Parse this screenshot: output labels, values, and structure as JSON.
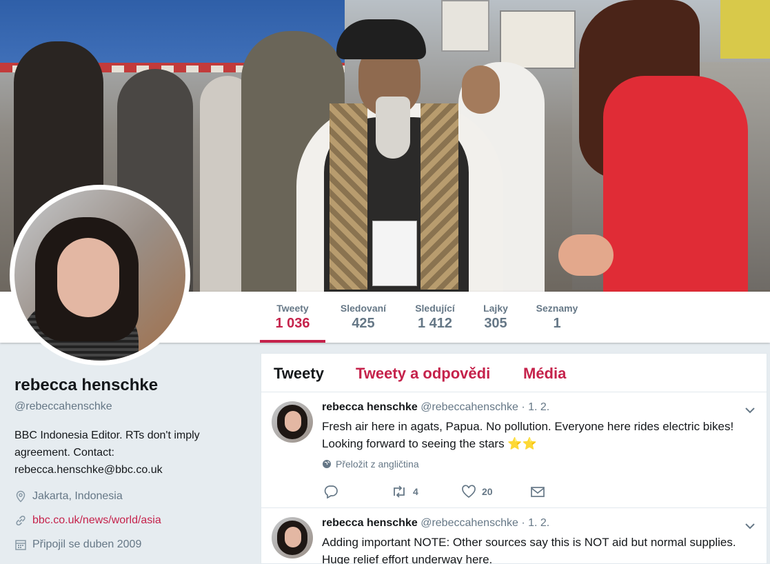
{
  "nav": {
    "items": [
      {
        "label": "Tweety",
        "value": "1 036"
      },
      {
        "label": "Sledovaní",
        "value": "425"
      },
      {
        "label": "Sledující",
        "value": "1 412"
      },
      {
        "label": "Lajky",
        "value": "305"
      },
      {
        "label": "Seznamy",
        "value": "1"
      }
    ]
  },
  "profile": {
    "name": "rebecca henschke",
    "handle": "@rebeccahenschke",
    "bio": "BBC Indonesia Editor. RTs don't imply agreement. Contact: rebecca.henschke@bbc.co.uk",
    "location": "Jakarta, Indonesia",
    "url": "bbc.co.uk/news/world/asia",
    "joined": "Připojil se duben 2009"
  },
  "timeline": {
    "tabs": [
      "Tweety",
      "Tweety a odpovědi",
      "Média"
    ],
    "tweets": [
      {
        "name": "rebecca henschke",
        "handle": "@rebeccahenschke",
        "date": "· 1. 2.",
        "text": "Fresh air here in agats, Papua. No pollution. Everyone here rides electric bikes! Looking forward to seeing the stars ⭐⭐",
        "translate": "Přeložit z angličtina",
        "retweets": "4",
        "likes": "20"
      },
      {
        "name": "rebecca henschke",
        "handle": "@rebeccahenschke",
        "date": "· 1. 2.",
        "text": "Adding important NOTE: Other sources say this is NOT aid but normal supplies. Huge relief effort underway here."
      }
    ]
  },
  "colors": {
    "accent": "#c5224b",
    "muted": "#657786",
    "background": "#e6ecf0"
  }
}
